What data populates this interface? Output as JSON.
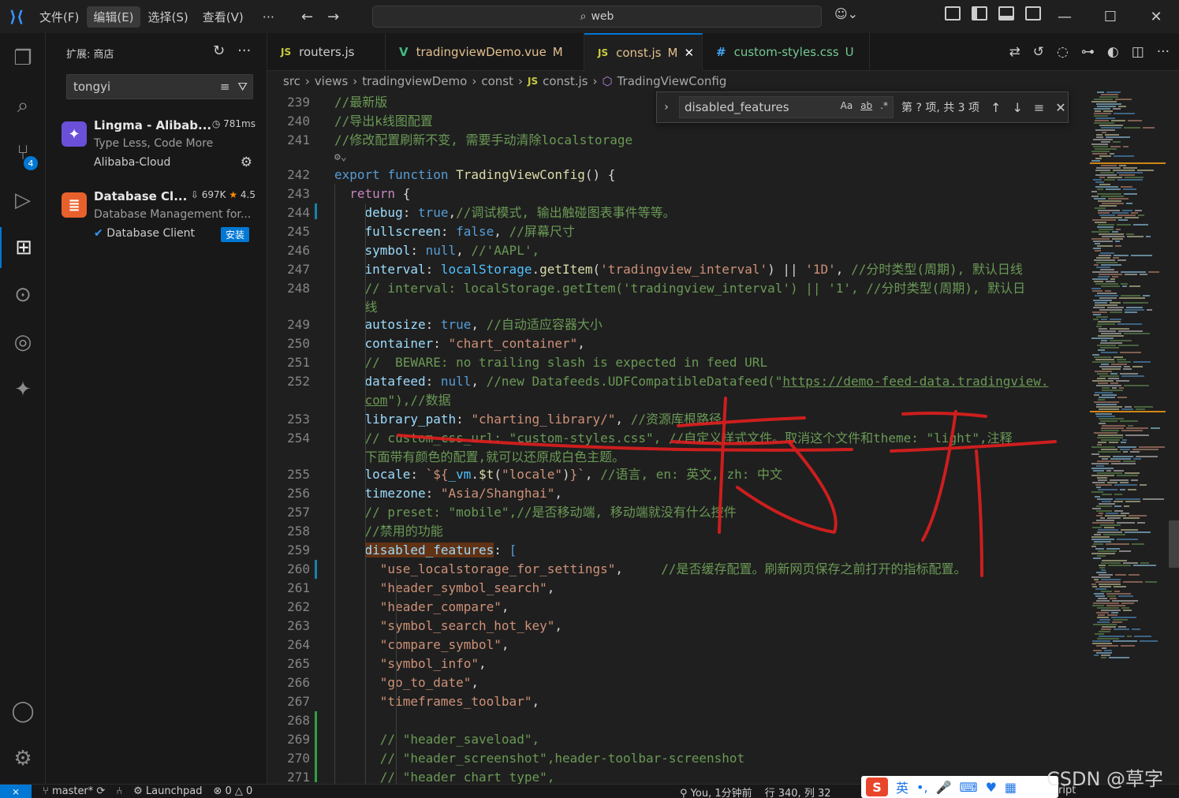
{
  "titlebar": {
    "menu": [
      "文件(F)",
      "编辑(E)",
      "选择(S)",
      "查看(V)"
    ],
    "more": "···",
    "search": "web"
  },
  "sidebar": {
    "header": "扩展: 商店",
    "search_value": "tongyi",
    "extensions": [
      {
        "name": "Lingma - Alibab...",
        "meta": "781ms",
        "desc": "Type Less, Code More",
        "publisher": "Alibaba-Cloud"
      },
      {
        "name": "Database Cl...",
        "downloads": "697K",
        "rating": "4.5",
        "desc": "Database Management for...",
        "publisher": "Database Client",
        "install": "安装"
      }
    ]
  },
  "activity": {
    "scm_badge": "4"
  },
  "tabs": [
    {
      "icon": "JS",
      "label": "routers.js",
      "mod": "",
      "icon_color": "#cbcb41"
    },
    {
      "icon": "V",
      "label": "tradingviewDemo.vue",
      "mod": "M",
      "icon_color": "#41b883"
    },
    {
      "icon": "JS",
      "label": "const.js",
      "mod": "M",
      "icon_color": "#cbcb41"
    },
    {
      "icon": "#",
      "label": "custom-styles.css",
      "mod": "U",
      "icon_color": "#42a5f5"
    }
  ],
  "breadcrumb": [
    "src",
    "views",
    "tradingviewDemo",
    "const",
    "const.js",
    "TradingViewConfig"
  ],
  "find": {
    "query": "disabled_features",
    "opt_case": "Aa",
    "opt_word": "ab",
    "opt_regex": ".*",
    "count": "第 ? 项, 共 3 项"
  },
  "editor": {
    "codelens": "⚙",
    "lines": [
      {
        "n": "239",
        "t": [
          [
            "c",
            "//最新版"
          ]
        ]
      },
      {
        "n": "240",
        "t": [
          [
            "c",
            "//导出k线图配置"
          ]
        ]
      },
      {
        "n": "241",
        "t": [
          [
            "c",
            "//修改配置刷新不变, 需要手动清除localstorage"
          ]
        ]
      },
      {
        "n": "242",
        "t": [
          [
            "k",
            "export "
          ],
          [
            "k",
            "function "
          ],
          [
            "f",
            "TradingViewConfig"
          ],
          [
            "",
            "() {"
          ]
        ]
      },
      {
        "n": "243",
        "t": [
          [
            "",
            "  "
          ],
          [
            "kc",
            "return "
          ],
          [
            "",
            "{"
          ]
        ]
      },
      {
        "n": "244",
        "t": [
          [
            "",
            "    "
          ],
          [
            "p",
            "debug"
          ],
          [
            "",
            ": "
          ],
          [
            "k",
            "true"
          ],
          [
            "",
            ","
          ],
          [
            "c",
            "//调试模式, 输出触碰图表事件等等。"
          ]
        ]
      },
      {
        "n": "245",
        "t": [
          [
            "",
            "    "
          ],
          [
            "p",
            "fullscreen"
          ],
          [
            "",
            ": "
          ],
          [
            "k",
            "false"
          ],
          [
            "",
            ", "
          ],
          [
            "c",
            "//屏幕尺寸"
          ]
        ]
      },
      {
        "n": "246",
        "t": [
          [
            "",
            "    "
          ],
          [
            "p",
            "symbol"
          ],
          [
            "",
            ": "
          ],
          [
            "k",
            "null"
          ],
          [
            "",
            ", "
          ],
          [
            "c",
            "//'AAPL',"
          ]
        ]
      },
      {
        "n": "247",
        "t": [
          [
            "",
            "    "
          ],
          [
            "p",
            "interval"
          ],
          [
            "",
            ": "
          ],
          [
            "v",
            "localStorage"
          ],
          [
            "",
            "."
          ],
          [
            "f",
            "getItem"
          ],
          [
            "",
            "("
          ],
          [
            "s",
            "'tradingview_interval'"
          ],
          [
            "",
            ") || "
          ],
          [
            "s",
            "'1D'"
          ],
          [
            "",
            ", "
          ],
          [
            "c",
            "//分时类型(周期), 默认日线"
          ]
        ]
      },
      {
        "n": "248",
        "t": [
          [
            "",
            "    "
          ],
          [
            "c",
            "// interval: localStorage.getItem('tradingview_interval') || '1', //分时类型(周期), 默认日"
          ]
        ]
      },
      {
        "n": "",
        "t": [
          [
            "",
            "    "
          ],
          [
            "c",
            "线"
          ]
        ]
      },
      {
        "n": "249",
        "t": [
          [
            "",
            "    "
          ],
          [
            "p",
            "autosize"
          ],
          [
            "",
            ": "
          ],
          [
            "k",
            "true"
          ],
          [
            "",
            ", "
          ],
          [
            "c",
            "//自动适应容器大小"
          ]
        ]
      },
      {
        "n": "250",
        "t": [
          [
            "",
            "    "
          ],
          [
            "p",
            "container"
          ],
          [
            "",
            ": "
          ],
          [
            "s",
            "\"chart_container\""
          ],
          [
            "",
            ","
          ]
        ]
      },
      {
        "n": "251",
        "t": [
          [
            "",
            "    "
          ],
          [
            "c",
            "//  BEWARE: no trailing slash is expected in feed URL"
          ]
        ]
      },
      {
        "n": "252",
        "t": [
          [
            "",
            "    "
          ],
          [
            "p",
            "datafeed"
          ],
          [
            "",
            ": "
          ],
          [
            "k",
            "null"
          ],
          [
            "",
            ", "
          ],
          [
            "c",
            "//new Datafeeds.UDFCompatibleDatafeed(\""
          ],
          [
            "cu",
            "https://demo-feed-data.tradingview."
          ]
        ]
      },
      {
        "n": "",
        "t": [
          [
            "",
            "    "
          ],
          [
            "cu",
            "com"
          ],
          [
            "c",
            "\"),//数据"
          ]
        ]
      },
      {
        "n": "253",
        "t": [
          [
            "",
            "    "
          ],
          [
            "p",
            "library_path"
          ],
          [
            "",
            ": "
          ],
          [
            "s",
            "\"charting_library/\""
          ],
          [
            "",
            ", "
          ],
          [
            "c",
            "//资源库根路径"
          ]
        ]
      },
      {
        "n": "254",
        "t": [
          [
            "",
            "    "
          ],
          [
            "c",
            "// custom_css_url: \"custom-styles.css\", //自定义样式文件。取消这个文件和theme: \"light\",注释"
          ]
        ]
      },
      {
        "n": "",
        "t": [
          [
            "",
            "    "
          ],
          [
            "c",
            "下面带有颜色的配置,就可以还原成白色主题。"
          ]
        ]
      },
      {
        "n": "255",
        "t": [
          [
            "",
            "    "
          ],
          [
            "p",
            "locale"
          ],
          [
            "",
            ": "
          ],
          [
            "s",
            "`${"
          ],
          [
            "v",
            "_vm"
          ],
          [
            "",
            "."
          ],
          [
            "f",
            "$t"
          ],
          [
            "",
            "("
          ],
          [
            "s",
            "\"locale\""
          ],
          [
            "",
            ")"
          ],
          [
            "s",
            "}`"
          ],
          [
            "",
            ", "
          ],
          [
            "c",
            "//语言, en: 英文, zh: 中文"
          ]
        ]
      },
      {
        "n": "256",
        "t": [
          [
            "",
            "    "
          ],
          [
            "p",
            "timezone"
          ],
          [
            "",
            ": "
          ],
          [
            "s",
            "\"Asia/Shanghai\""
          ],
          [
            "",
            ","
          ]
        ]
      },
      {
        "n": "257",
        "t": [
          [
            "",
            "    "
          ],
          [
            "c",
            "// preset: \"mobile\",//是否移动端, 移动端就没有什么控件"
          ]
        ]
      },
      {
        "n": "258",
        "t": [
          [
            "",
            "    "
          ],
          [
            "c",
            "//禁用的功能"
          ]
        ]
      },
      {
        "n": "259",
        "t": [
          [
            "",
            "    "
          ],
          [
            "php",
            "disabled_features"
          ],
          [
            "",
            ": "
          ],
          [
            "k",
            "["
          ]
        ]
      },
      {
        "n": "260",
        "t": [
          [
            "",
            "      "
          ],
          [
            "s",
            "\"use_localstorage_for_settings\""
          ],
          [
            "",
            ",     "
          ],
          [
            "c",
            "//是否缓存配置。刷新网页保存之前打开的指标配置。"
          ]
        ]
      },
      {
        "n": "261",
        "t": [
          [
            "",
            "      "
          ],
          [
            "s",
            "\"header_symbol_search\""
          ],
          [
            "",
            ","
          ]
        ]
      },
      {
        "n": "262",
        "t": [
          [
            "",
            "      "
          ],
          [
            "s",
            "\"header_compare\""
          ],
          [
            "",
            ","
          ]
        ]
      },
      {
        "n": "263",
        "t": [
          [
            "",
            "      "
          ],
          [
            "s",
            "\"symbol_search_hot_key\""
          ],
          [
            "",
            ","
          ]
        ]
      },
      {
        "n": "264",
        "t": [
          [
            "",
            "      "
          ],
          [
            "s",
            "\"compare_symbol\""
          ],
          [
            "",
            ","
          ]
        ]
      },
      {
        "n": "265",
        "t": [
          [
            "",
            "      "
          ],
          [
            "s",
            "\"symbol_info\""
          ],
          [
            "",
            ","
          ]
        ]
      },
      {
        "n": "266",
        "t": [
          [
            "",
            "      "
          ],
          [
            "s",
            "\"go_to_date\""
          ],
          [
            "",
            ","
          ]
        ]
      },
      {
        "n": "267",
        "t": [
          [
            "",
            "      "
          ],
          [
            "s",
            "\"timeframes_toolbar\""
          ],
          [
            "",
            ","
          ]
        ]
      },
      {
        "n": "268",
        "t": []
      },
      {
        "n": "269",
        "t": [
          [
            "",
            "      "
          ],
          [
            "c",
            "// \"header_saveload\","
          ]
        ]
      },
      {
        "n": "270",
        "t": [
          [
            "",
            "      "
          ],
          [
            "c",
            "// \"header_screenshot\",header-toolbar-screenshot"
          ]
        ]
      },
      {
        "n": "271",
        "t": [
          [
            "",
            "      "
          ],
          [
            "c",
            "// \"header_chart_type\","
          ]
        ]
      }
    ]
  },
  "annotation_text": "去开",
  "status": {
    "branch": "master*",
    "launchpad": "Launchpad",
    "errors": "0",
    "warnings": "0",
    "blame": "You, 1分钟前",
    "position": "行 340, 列 32",
    "lang_tail": "ript"
  },
  "ime": {
    "logo": "S",
    "lang": "英"
  },
  "watermark": "CSDN @草字"
}
